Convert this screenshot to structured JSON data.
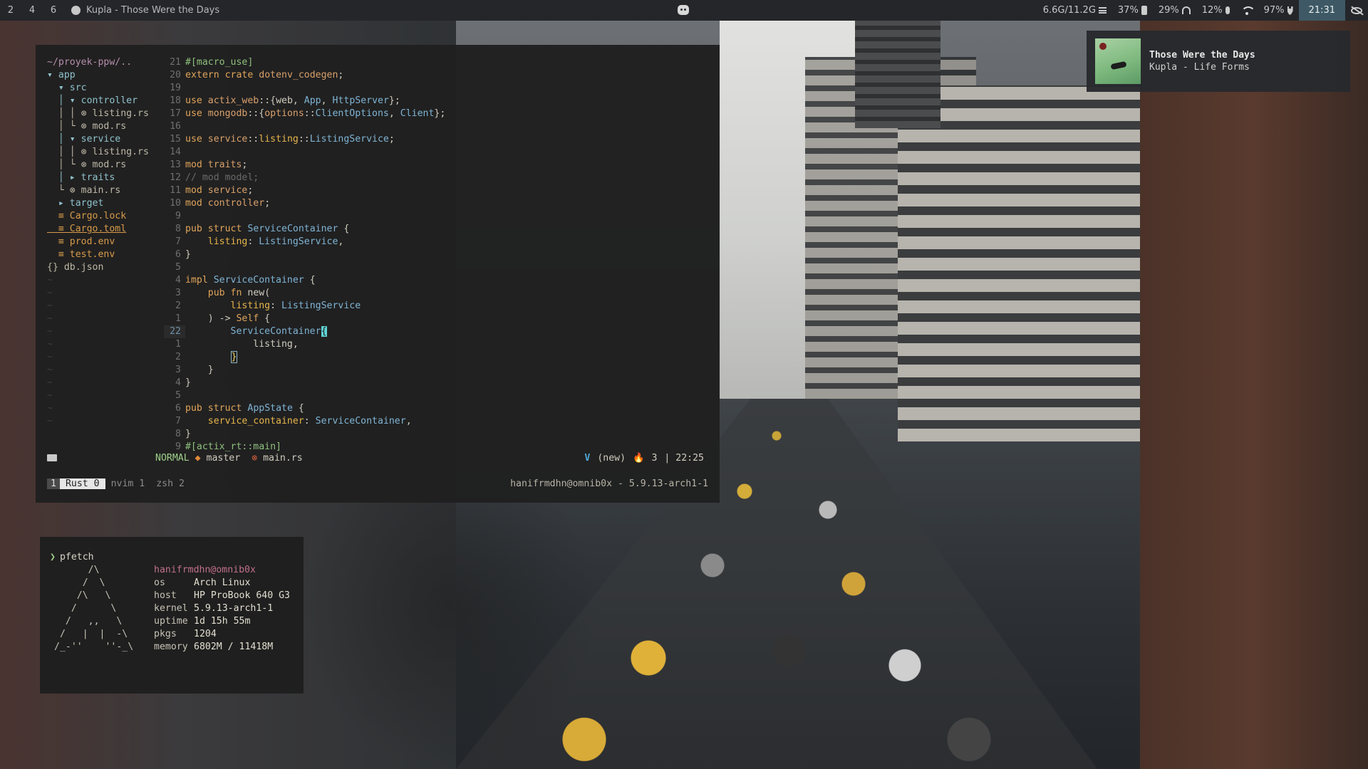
{
  "topbar": {
    "workspaces": [
      "2",
      "4",
      "6"
    ],
    "media_title": "Kupla - Those Were the Days",
    "memory": "6.6G/11.2G",
    "battery": "37%",
    "headphone": "29%",
    "mic": "12%",
    "power": "97%",
    "clock": "21:31"
  },
  "notification": {
    "title": "Those Were the Days",
    "subtitle": "Kupla - Life Forms"
  },
  "file_tree": [
    {
      "text": "~/proyek-ppw/..",
      "kind": "path"
    },
    {
      "text": "▾ app",
      "kind": "dir"
    },
    {
      "text": "  ▾ src",
      "kind": "dir"
    },
    {
      "text": "  │ ▾ controller",
      "kind": "dir"
    },
    {
      "text": "  │ │ ⊗ listing.rs",
      "kind": "rs"
    },
    {
      "text": "  │ └ ⊗ mod.rs",
      "kind": "rs"
    },
    {
      "text": "  │ ▾ service",
      "kind": "dir"
    },
    {
      "text": "  │ │ ⊗ listing.rs",
      "kind": "rs"
    },
    {
      "text": "  │ └ ⊗ mod.rs",
      "kind": "rs"
    },
    {
      "text": "  │ ▸ traits",
      "kind": "dir"
    },
    {
      "text": "  └ ⊗ main.rs",
      "kind": "rs"
    },
    {
      "text": "  ▸ target",
      "kind": "dir"
    },
    {
      "text": "  ≡ Cargo.lock",
      "kind": "file"
    },
    {
      "text": "  ≡ Cargo.toml",
      "kind": "file"
    },
    {
      "text": "  ≡ prod.env",
      "kind": "file"
    },
    {
      "text": "  ≡ test.env",
      "kind": "file"
    },
    {
      "text": "{} db.json",
      "kind": "plain"
    }
  ],
  "code_lines": [
    {
      "n": "21",
      "t": "#[macro_use]"
    },
    {
      "n": "20",
      "t": "extern crate dotenv_codegen;"
    },
    {
      "n": "19",
      "t": ""
    },
    {
      "n": "18",
      "t": "use actix_web::{web, App, HttpServer};"
    },
    {
      "n": "17",
      "t": "use mongodb::{options::ClientOptions, Client};"
    },
    {
      "n": "16",
      "t": ""
    },
    {
      "n": "15",
      "t": "use service::listing::ListingService;"
    },
    {
      "n": "14",
      "t": ""
    },
    {
      "n": "13",
      "t": "mod traits;"
    },
    {
      "n": "12",
      "t": "// mod model;"
    },
    {
      "n": "11",
      "t": "mod service;"
    },
    {
      "n": "10",
      "t": "mod controller;"
    },
    {
      "n": "9",
      "t": ""
    },
    {
      "n": "8",
      "t": "pub struct ServiceContainer {"
    },
    {
      "n": "7",
      "t": "    listing: ListingService,"
    },
    {
      "n": "6",
      "t": "}"
    },
    {
      "n": "5",
      "t": ""
    },
    {
      "n": "4",
      "t": "impl ServiceContainer {"
    },
    {
      "n": "3",
      "t": "    pub fn new("
    },
    {
      "n": "2",
      "t": "        listing: ListingService"
    },
    {
      "n": "1",
      "t": "    ) -> Self {"
    },
    {
      "n": "22",
      "t": "        ServiceContainer{"
    },
    {
      "n": "1",
      "t": "            listing,"
    },
    {
      "n": "2",
      "t": "        }"
    },
    {
      "n": "3",
      "t": "    }"
    },
    {
      "n": "4",
      "t": "}"
    },
    {
      "n": "5",
      "t": ""
    },
    {
      "n": "6",
      "t": "pub struct AppState {"
    },
    {
      "n": "7",
      "t": "    service_container: ServiceContainer,"
    },
    {
      "n": "8",
      "t": "}"
    },
    {
      "n": "9",
      "t": "#[actix_rt::main]"
    }
  ],
  "statusline": {
    "mode": "NORMAL",
    "branch": "master",
    "file": "main.rs",
    "vim_flag": "V",
    "buffer_state": "(new)",
    "count": "3",
    "position": "| 22:25"
  },
  "tmux": {
    "session_index": "1",
    "active_window": "Rust 0",
    "windows": [
      "nvim 1",
      "zsh 2"
    ],
    "host_info": "hanifrmdhn@omnib0x - 5.9.13-arch1-1"
  },
  "pfetch": {
    "command": "pfetch",
    "logo": [
      "      /\\",
      "     /  \\",
      "    /\\   \\",
      "   /      \\",
      "  /   ,,   \\",
      " /   |  |  -\\",
      "/_-''    ''-_\\"
    ],
    "user": "hanifrmdhn@omnib0x",
    "rows": [
      {
        "key": "os",
        "val": "Arch Linux"
      },
      {
        "key": "host",
        "val": "HP ProBook 640 G3"
      },
      {
        "key": "kernel",
        "val": "5.9.13-arch1-1"
      },
      {
        "key": "uptime",
        "val": "1d 15h 55m"
      },
      {
        "key": "pkgs",
        "val": "1204"
      },
      {
        "key": "memory",
        "val": "6802M / 11418M"
      }
    ]
  }
}
